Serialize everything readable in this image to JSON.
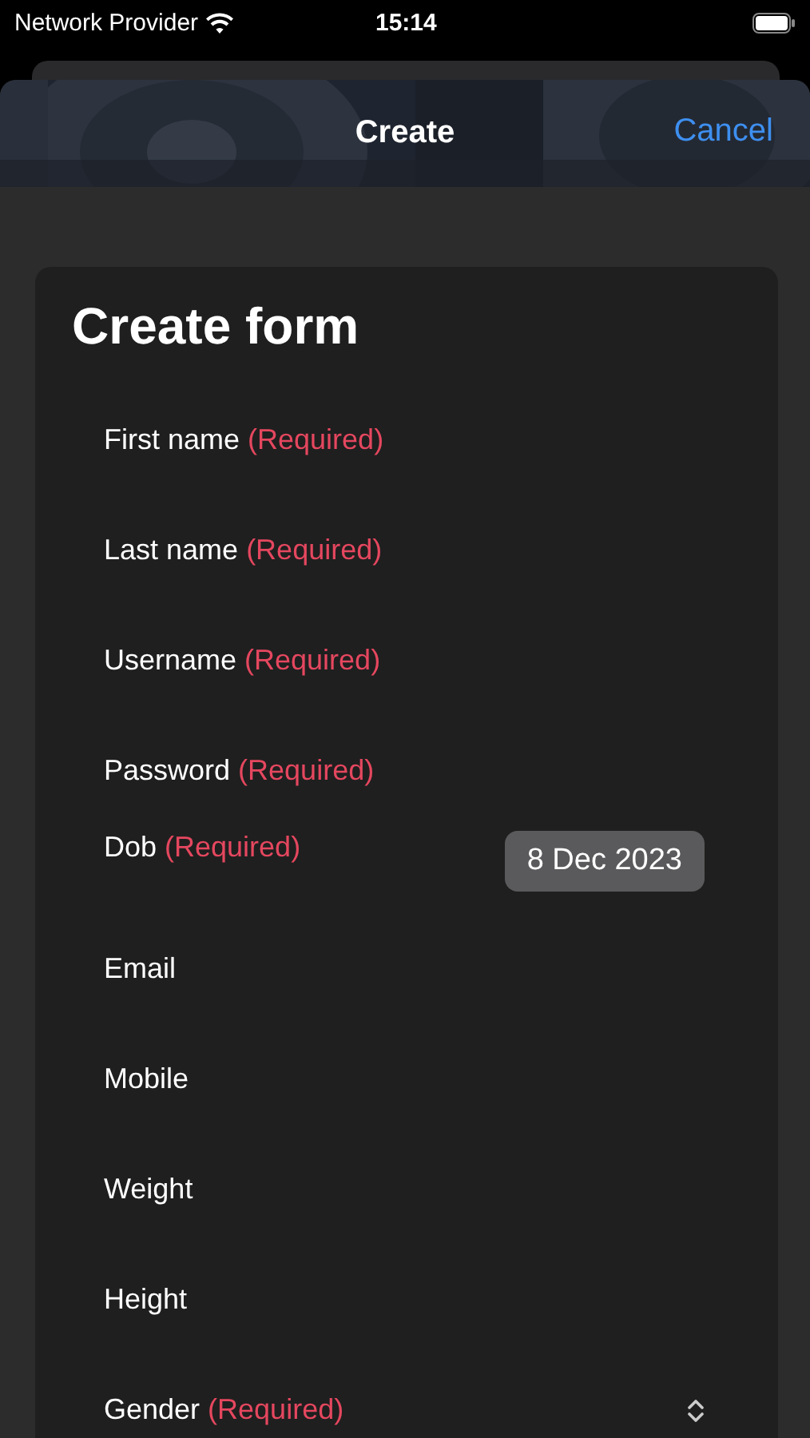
{
  "status_bar": {
    "carrier": "Network Provider",
    "time": "15:14"
  },
  "nav": {
    "title": "Create",
    "cancel": "Cancel"
  },
  "form": {
    "title": "Create form",
    "fields": [
      {
        "kind": "text",
        "label": "First name",
        "required_text": "(Required)"
      },
      {
        "kind": "text",
        "label": "Last name",
        "required_text": "(Required)"
      },
      {
        "kind": "text",
        "label": "Username",
        "required_text": "(Required)"
      },
      {
        "kind": "text",
        "label": "Password",
        "required_text": "(Required)"
      },
      {
        "kind": "date",
        "label": "Dob",
        "required_text": "(Required)",
        "value": "8 Dec 2023"
      },
      {
        "kind": "text",
        "label": "Email"
      },
      {
        "kind": "text",
        "label": "Mobile"
      },
      {
        "kind": "text",
        "label": "Weight"
      },
      {
        "kind": "text",
        "label": "Height"
      },
      {
        "kind": "picker",
        "label": "Gender",
        "required_text": "(Required)"
      }
    ]
  }
}
